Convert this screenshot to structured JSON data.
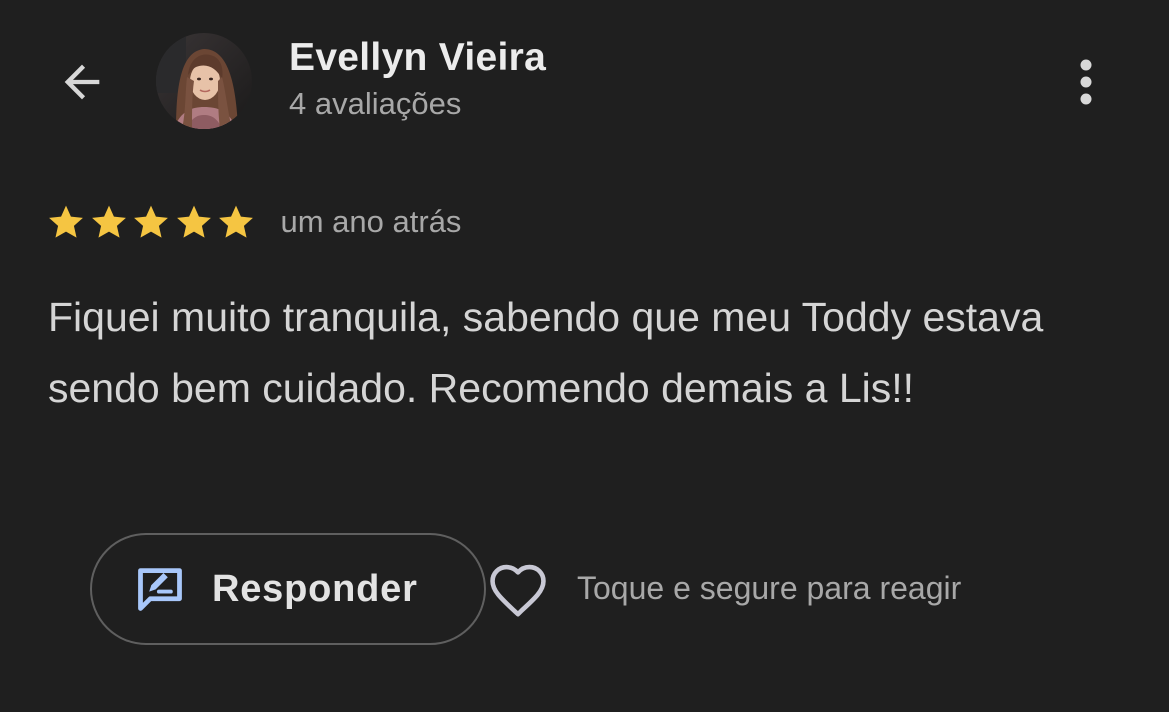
{
  "header": {
    "author_name": "Evellyn Vieira",
    "author_reviews": "4 avaliações",
    "back_icon": "arrow-back-icon",
    "more_icon": "more-vert-icon"
  },
  "review": {
    "rating": 5,
    "rating_max": 5,
    "time_ago": "um ano atrás",
    "text": "Fiquei muito tranquila, sabendo que meu Toddy estava sendo bem cuidado. Recomendo demais a Lis!!"
  },
  "actions": {
    "reply_label": "Responder",
    "reply_icon": "reply-edit-icon",
    "react_icon": "heart-outline-icon",
    "react_hint": "Toque e segure para reagir"
  },
  "colors": {
    "background": "#1f1f1f",
    "star": "#f5c542",
    "reply_icon": "#a8c7fa",
    "secondary_text": "#a8a8a8"
  }
}
